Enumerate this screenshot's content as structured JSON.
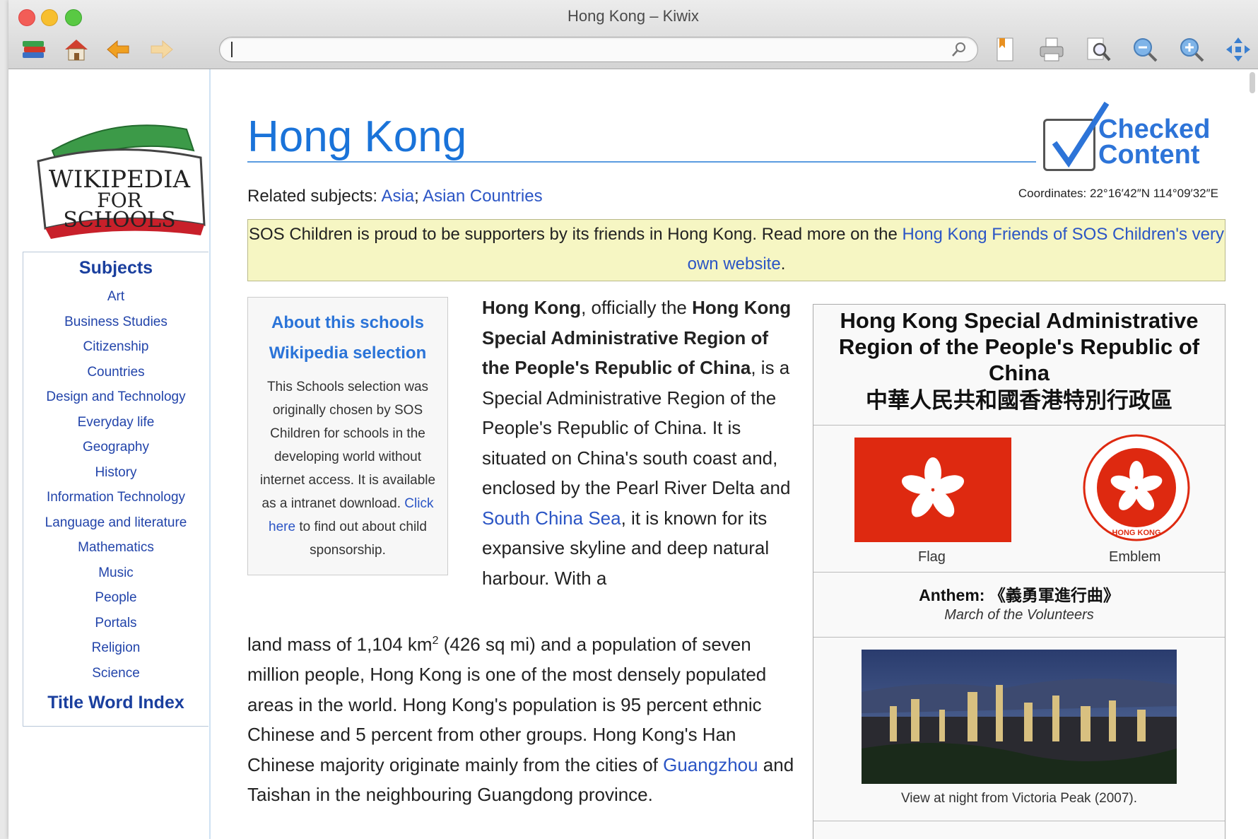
{
  "window": {
    "title": "Hong Kong – Kiwix"
  },
  "toolbar": {
    "icons": [
      "library-icon",
      "home-icon",
      "back-icon",
      "forward-icon",
      "bookmark-icon",
      "print-icon",
      "find-icon",
      "zoom-out-icon",
      "zoom-in-icon",
      "fullscreen-icon"
    ],
    "url_value": ""
  },
  "sidebar": {
    "logo": {
      "line1": "WIKIPEDIA",
      "line2": "FOR",
      "line3": "SCHOOLS"
    },
    "subjects_title": "Subjects",
    "items": [
      "Art",
      "Business Studies",
      "Citizenship",
      "Countries",
      "Design and Technology",
      "Everyday life",
      "Geography",
      "History",
      "Information Technology",
      "Language and literature",
      "Mathematics",
      "Music",
      "People",
      "Portals",
      "Religion",
      "Science"
    ],
    "title_word_index": "Title Word Index"
  },
  "article": {
    "title": "Hong Kong",
    "checked": {
      "line1": "Checked",
      "line2": "Content"
    },
    "related_label": "Related subjects: ",
    "related_links": [
      "Asia",
      "Asian Countries"
    ],
    "related_sep": "; ",
    "coordinates": "Coordinates: 22°16′42″N 114°09′32″E",
    "sos": {
      "text": "SOS Children is proud to be supporters by its friends in Hong Kong. Read more on the ",
      "link": "Hong Kong Friends of SOS Children's very own website",
      "end": "."
    },
    "about": {
      "title": "About this schools Wikipedia selection",
      "text": "This Schools selection was originally chosen by SOS Children for schools in the developing world without internet access. It is available as a intranet download. ",
      "link": "Click here",
      "text_end": " to find out about child sponsorship."
    },
    "intro": {
      "b1": "Hong Kong",
      "t1": ", officially the ",
      "b2": "Hong Kong Special Administrative Region of the People's Republic of China",
      "t2": ", is a Special Administrative Region of the People's Republic of China. It is situated on China's south coast and, enclosed by the Pearl River Delta and ",
      "link1": "South China Sea",
      "t3": ", it is known for its expansive skyline and deep natural harbour. With a"
    },
    "body": {
      "t1": "land mass of 1,104 km",
      "sup": "2",
      "t2": " (426 sq mi) and a population of seven million people, Hong Kong is one of the most densely populated areas in the world. Hong Kong's population is 95 percent ethnic Chinese and 5 percent from other groups. Hong Kong's Han Chinese majority originate mainly from the cities of ",
      "link": "Guangzhou",
      "t3": " and Taishan in the neighbouring Guangdong province."
    },
    "infobox": {
      "title": "Hong Kong Special Administrative Region of the People's Republic of China",
      "title_zh": "中華人民共和國香港特別行政區",
      "flag_caption": "Flag",
      "emblem_caption": "Emblem",
      "emblem_text": "HONG KONG",
      "anthem_label": "Anthem: ",
      "anthem_value": "《義勇軍進行曲》",
      "anthem_sub": "March of the Volunteers",
      "photo_caption": "View at night from Victoria Peak (2007)."
    }
  },
  "colors": {
    "link": "#2b55c5",
    "title": "#1a73d9",
    "sos_bg": "#f6f6c3",
    "flag_red": "#de2910"
  }
}
